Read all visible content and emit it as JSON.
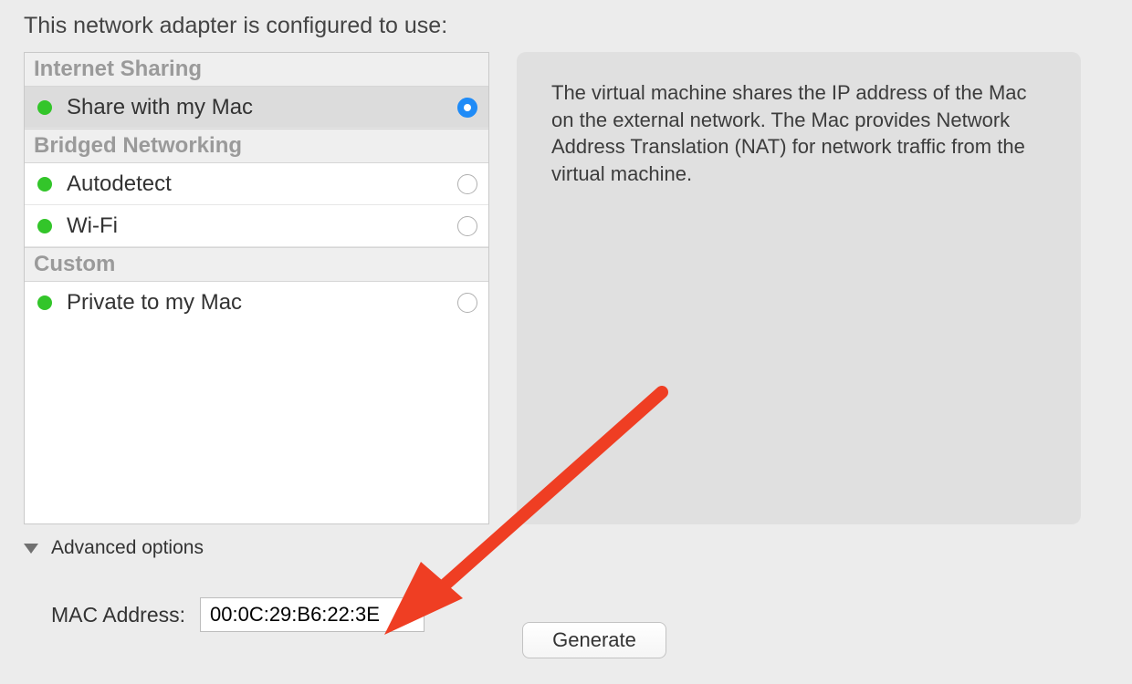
{
  "title": "This network adapter is configured to use:",
  "sections": {
    "internet_sharing": {
      "header": "Internet Sharing",
      "items": [
        {
          "label": "Share with my Mac",
          "status": "green",
          "selected": true
        }
      ]
    },
    "bridged": {
      "header": "Bridged Networking",
      "items": [
        {
          "label": "Autodetect",
          "status": "green",
          "selected": false
        },
        {
          "label": "Wi-Fi",
          "status": "green",
          "selected": false
        }
      ]
    },
    "custom": {
      "header": "Custom",
      "items": [
        {
          "label": "Private to my Mac",
          "status": "green",
          "selected": false
        }
      ]
    }
  },
  "description": "The virtual machine shares the IP address of the Mac on the external network. The Mac provides Network Address Translation (NAT) for network traffic from the virtual machine.",
  "advanced_label": "Advanced options",
  "mac_address": {
    "label": "MAC Address:",
    "value": "00:0C:29:B6:22:3E"
  },
  "generate_label": "Generate",
  "colors": {
    "status_green": "#33c52a",
    "radio_checked": "#1f8bf7",
    "arrow": "#ef3e23"
  }
}
